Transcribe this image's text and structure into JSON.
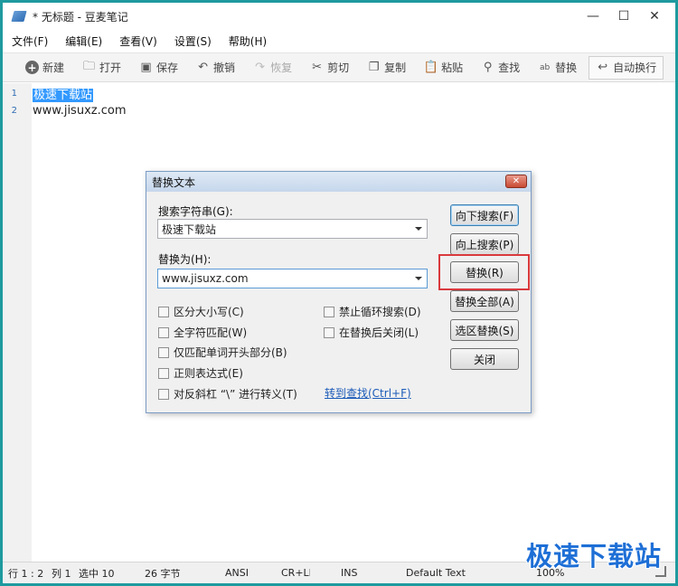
{
  "window": {
    "title": "* 无标题 - 豆麦笔记"
  },
  "menu": [
    "文件(F)",
    "编辑(E)",
    "查看(V)",
    "设置(S)",
    "帮助(H)"
  ],
  "toolbar": {
    "new": "新建",
    "open": "打开",
    "save": "保存",
    "undo": "撤销",
    "redo": "恢复",
    "cut": "剪切",
    "copy": "复制",
    "paste": "粘贴",
    "find": "查找",
    "replace": "替换",
    "wrap": "自动换行"
  },
  "editor": {
    "lines": [
      {
        "num": "1",
        "text": "极速下载站"
      },
      {
        "num": "2",
        "text": "www.jisuxz.com"
      }
    ]
  },
  "dialog": {
    "title": "替换文本",
    "search_label": "搜索字符串(G):",
    "search_value": "极速下载站",
    "replace_label": "替换为(H):",
    "replace_value": "www.jisuxz.com",
    "options": {
      "case": "区分大小写(C)",
      "whole": "全字符匹配(W)",
      "prefix": "仅匹配单词开头部分(B)",
      "regex": "正则表达式(E)",
      "escape": "对反斜杠 “\\” 进行转义(T)",
      "noloop": "禁止循环搜索(D)",
      "closeafter": "在替换后关闭(L)"
    },
    "goto_find": "转到查找(Ctrl+F)",
    "buttons": {
      "down": "向下搜索(F)",
      "up": "向上搜索(P)",
      "replace": "替换(R)",
      "replace_all": "替换全部(A)",
      "replace_sel": "选区替换(S)",
      "close": "关闭"
    }
  },
  "status": {
    "position": "行 1 : 2",
    "col": "列 1",
    "sel": "选中 10",
    "bytes": "26 字节",
    "encoding": "ANSI",
    "eol": "CR+LF",
    "mode": "INS",
    "font": "Default Text",
    "zoom": "100%"
  },
  "watermark": "极速下载站",
  "colors": {
    "border": "#1e9a9e",
    "selection": "#3399ff",
    "highlight": "#d9393d",
    "link": "#1c5bb8"
  }
}
